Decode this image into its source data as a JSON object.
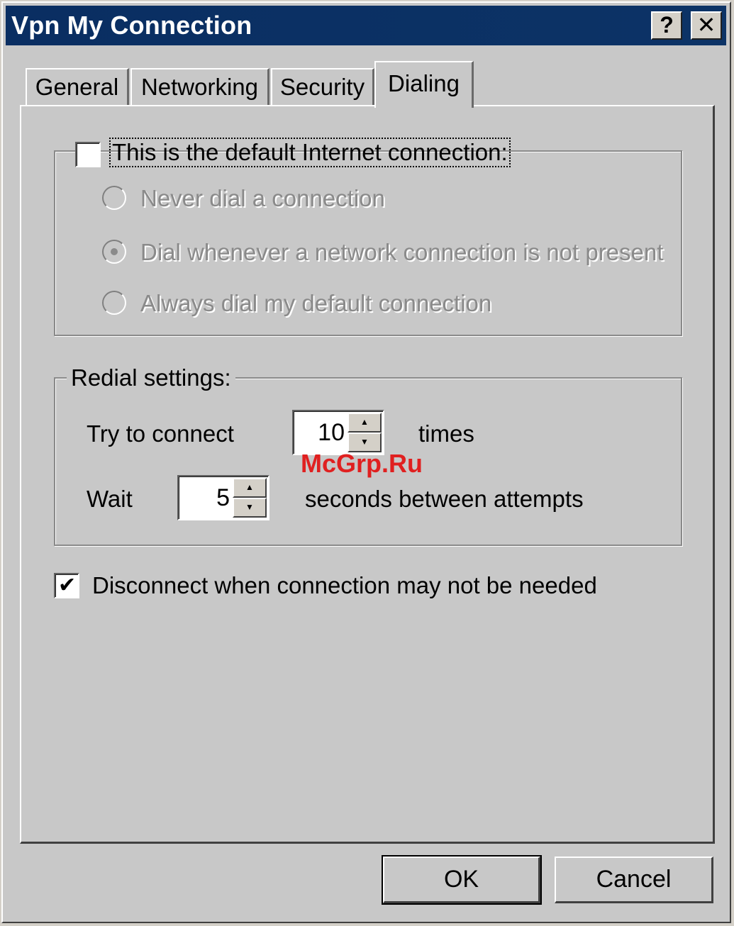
{
  "window": {
    "title": "Vpn My Connection",
    "help_label": "?",
    "close_label": "✕"
  },
  "tabs": [
    {
      "label": "General",
      "active": false
    },
    {
      "label": "Networking",
      "active": false
    },
    {
      "label": "Security",
      "active": false
    },
    {
      "label": "Dialing",
      "active": true
    }
  ],
  "default_connection": {
    "label": "This is the default Internet connection:",
    "checked": false,
    "options": [
      {
        "label": "Never dial a connection",
        "selected": false
      },
      {
        "label": "Dial whenever a network connection is not present",
        "selected": true
      },
      {
        "label": "Always dial my default connection",
        "selected": false
      }
    ]
  },
  "redial": {
    "title": "Redial settings:",
    "try_label": "Try to connect",
    "try_value": "10",
    "times_label": "times",
    "wait_label": "Wait",
    "wait_value": "5",
    "seconds_label": "seconds between attempts"
  },
  "disconnect": {
    "label": "Disconnect when connection may not be needed",
    "checked": true
  },
  "buttons": {
    "ok": "OK",
    "cancel": "Cancel"
  },
  "watermark": "McGrp.Ru",
  "colors": {
    "titlebar": "#0a2e62",
    "face": "#c8c8c8",
    "disabled_text": "#8a8a8a",
    "watermark": "#e02020"
  }
}
